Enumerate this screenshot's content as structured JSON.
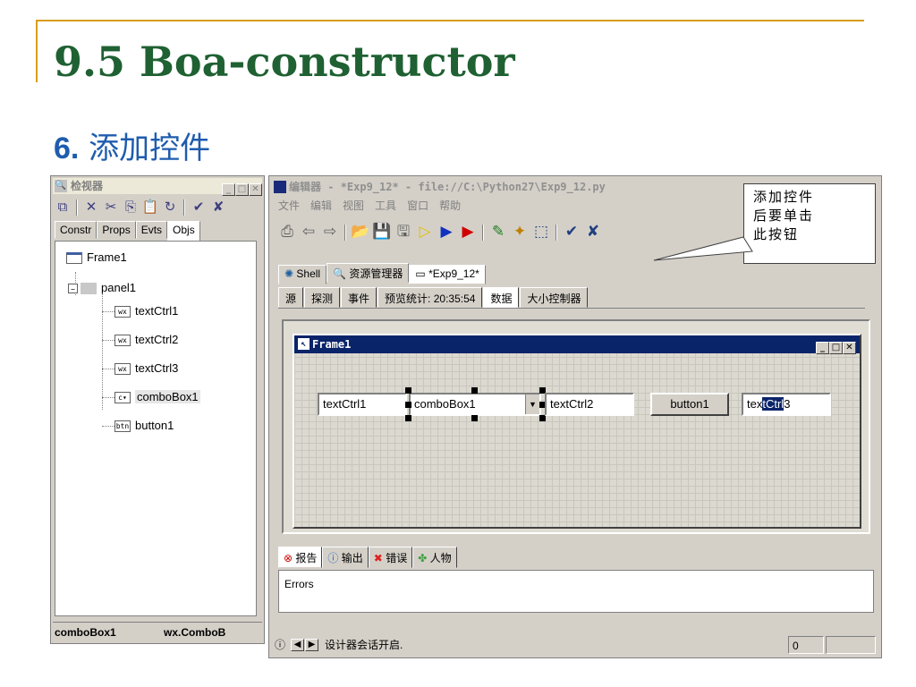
{
  "slide": {
    "title": "9.5  Boa-constructor",
    "subtitle_num": "6.",
    "subtitle_text": " 添加控件"
  },
  "inspector": {
    "title": "检视器",
    "toolbar_icons": [
      "inspector-icon",
      "close-x-icon",
      "cut-icon",
      "copy-icon",
      "paste-icon",
      "refresh-icon",
      "check-icon",
      "cancel-icon"
    ],
    "tabs": [
      "Constr",
      "Props",
      "Evts",
      "Objs"
    ],
    "active_tab": "Objs",
    "tree": {
      "frame": "Frame1",
      "panel": "panel1",
      "children": [
        {
          "label": "textCtrl1",
          "icon": "wx"
        },
        {
          "label": "textCtrl2",
          "icon": "wx"
        },
        {
          "label": "textCtrl3",
          "icon": "wx"
        },
        {
          "label": "comboBox1",
          "icon": "cb"
        },
        {
          "label": "button1",
          "icon": "btn"
        }
      ],
      "selected": "comboBox1"
    },
    "status": {
      "name": "comboBox1",
      "class": "wx.ComboB"
    }
  },
  "editor": {
    "title": "编辑器 - *Exp9_12* - file://C:\\Python27\\Exp9_12.py",
    "menu": [
      "文件",
      "编辑",
      "视图",
      "工具",
      "窗口",
      "帮助"
    ],
    "callout": "添加控件\n后要单击\n此按钮",
    "file_tabs": [
      {
        "label": "Shell",
        "icon": "shell-icon"
      },
      {
        "label": "资源管理器",
        "icon": "explorer-icon"
      },
      {
        "label": "*Exp9_12*",
        "icon": "frame-icon"
      }
    ],
    "sub_tabs": [
      "源",
      "探测",
      "事件",
      "预览统计: 20:35:54",
      "数据",
      "大小控制器"
    ],
    "frame": {
      "title": "Frame1",
      "controls": {
        "text1": "textCtrl1",
        "combo": "comboBox1",
        "text2": "textCtrl2",
        "button": "button1",
        "text3_prefix": "tex",
        "text3_hl": "tCtrl",
        "text3_suffix": "3"
      }
    },
    "bottom_tabs": [
      {
        "label": "报告",
        "icon": "report-icon"
      },
      {
        "label": "输出",
        "icon": "output-icon"
      },
      {
        "label": "错误",
        "icon": "error-icon"
      },
      {
        "label": "人物",
        "icon": "people-icon"
      }
    ],
    "errors_text": "Errors",
    "status": {
      "message": "设计器会话开启.",
      "value": "0"
    }
  }
}
